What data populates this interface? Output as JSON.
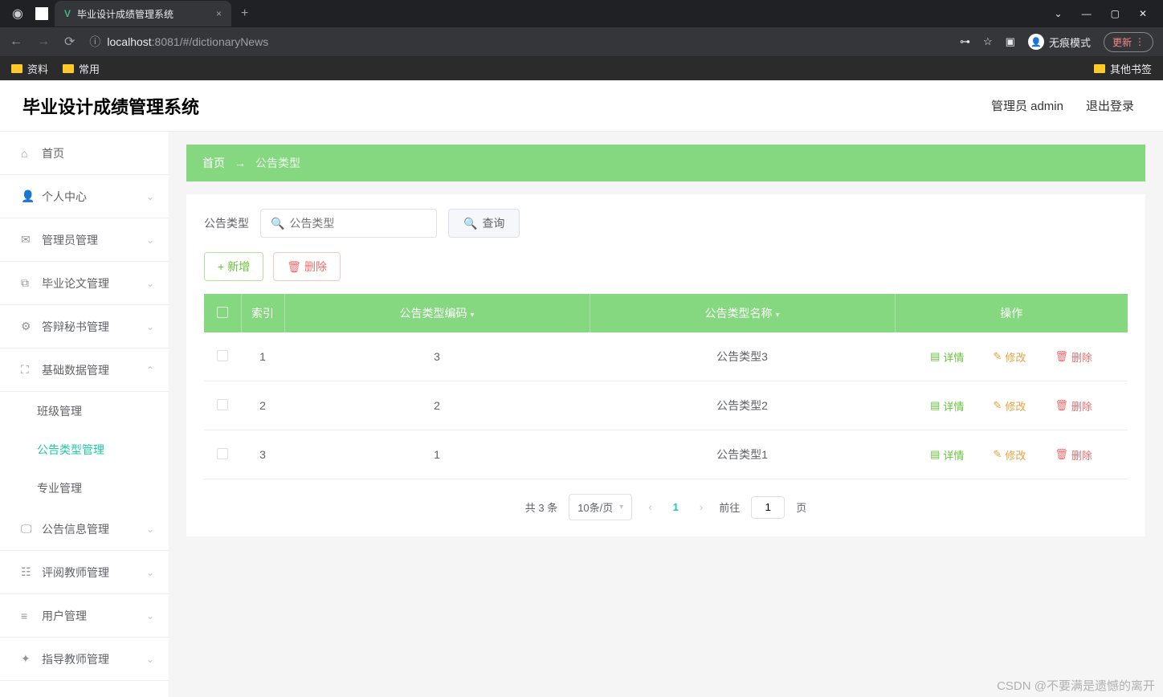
{
  "browser": {
    "tab_title": "毕业设计成绩管理系统",
    "url_host": "localhost",
    "url_path": ":8081/#/dictionaryNews",
    "incognito_label": "无痕模式",
    "update_label": "更新",
    "bookmarks": {
      "b1": "资料",
      "b2": "常用",
      "other": "其他书签"
    }
  },
  "header": {
    "title": "毕业设计成绩管理系统",
    "user": "管理员 admin",
    "logout": "退出登录"
  },
  "sidebar": {
    "items": [
      {
        "label": "首页",
        "icon": "home",
        "expandable": false
      },
      {
        "label": "个人中心",
        "icon": "user",
        "expandable": true
      },
      {
        "label": "管理员管理",
        "icon": "mail",
        "expandable": true
      },
      {
        "label": "毕业论文管理",
        "icon": "copy",
        "expandable": true
      },
      {
        "label": "答辩秘书管理",
        "icon": "gear",
        "expandable": true
      },
      {
        "label": "基础数据管理",
        "icon": "expand",
        "expandable": true,
        "open": true,
        "children": [
          {
            "label": "班级管理"
          },
          {
            "label": "公告类型管理",
            "active": true
          },
          {
            "label": "专业管理"
          }
        ]
      },
      {
        "label": "公告信息管理",
        "icon": "monitor",
        "expandable": true
      },
      {
        "label": "评阅教师管理",
        "icon": "list",
        "expandable": true
      },
      {
        "label": "用户管理",
        "icon": "menu",
        "expandable": true
      },
      {
        "label": "指导教师管理",
        "icon": "star",
        "expandable": true
      }
    ]
  },
  "breadcrumb": {
    "home": "首页",
    "sep": "→",
    "current": "公告类型"
  },
  "filter": {
    "label": "公告类型",
    "placeholder": "公告类型",
    "query": "查询"
  },
  "actions": {
    "add": "新增",
    "delete": "删除"
  },
  "table": {
    "headers": {
      "index": "索引",
      "code": "公告类型编码",
      "name": "公告类型名称",
      "ops": "操作"
    },
    "row_actions": {
      "detail": "详情",
      "edit": "修改",
      "delete": "删除"
    },
    "rows": [
      {
        "index": "1",
        "code": "3",
        "name": "公告类型3"
      },
      {
        "index": "2",
        "code": "2",
        "name": "公告类型2"
      },
      {
        "index": "3",
        "code": "1",
        "name": "公告类型1"
      }
    ]
  },
  "pagination": {
    "total": "共 3 条",
    "page_size": "10条/页",
    "current": "1",
    "goto_prefix": "前往",
    "goto_value": "1",
    "goto_suffix": "页"
  },
  "watermark": "CSDN @不要满是遗憾的离开"
}
